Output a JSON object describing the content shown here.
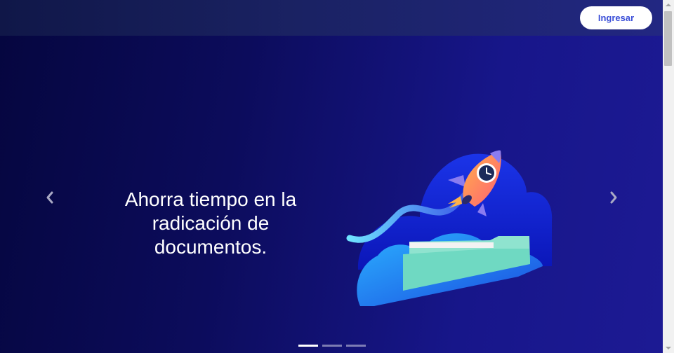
{
  "header": {
    "login_label": "Ingresar"
  },
  "carousel": {
    "slide_text": "Ahorra tiempo en la radicación de documentos.",
    "indicators": [
      {
        "active": true
      },
      {
        "active": false
      },
      {
        "active": false
      }
    ],
    "prev_icon": "chevron-left-icon",
    "next_icon": "chevron-right-icon"
  },
  "colors": {
    "background_start": "#05063f",
    "background_end": "#1d1a94",
    "button_text": "#3b4fd8"
  }
}
